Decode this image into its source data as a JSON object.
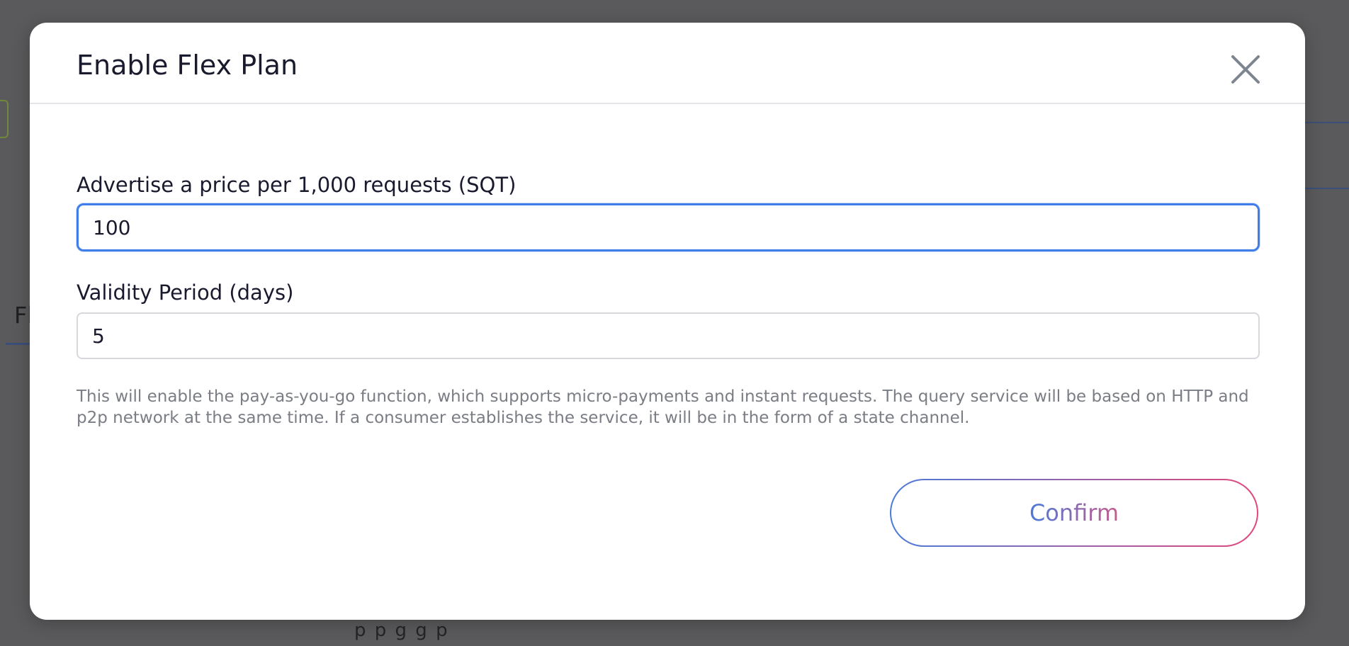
{
  "background": {
    "tab_fragment": "Fl",
    "bottom_fragment": "p  p  g                                          g  p"
  },
  "modal": {
    "title": "Enable Flex Plan",
    "close_icon": "close-icon",
    "price_field": {
      "label": "Advertise a price per 1,000 requests (SQT)",
      "value": "100"
    },
    "validity_field": {
      "label": "Validity Period (days)",
      "value": "5"
    },
    "description": "This will enable the pay-as-you-go function, which supports micro-payments and instant requests. The query service will be based on HTTP and p2p network at the same time. If a consumer establishes the service, it will be in the form of a state channel.",
    "confirm_label": "Confirm"
  },
  "colors": {
    "overlay": "#5a5a5c",
    "focus_border": "#3f7ee8",
    "gradient_start": "#4a7bd8",
    "gradient_end": "#e2487c",
    "description_text": "#7b7d85"
  }
}
